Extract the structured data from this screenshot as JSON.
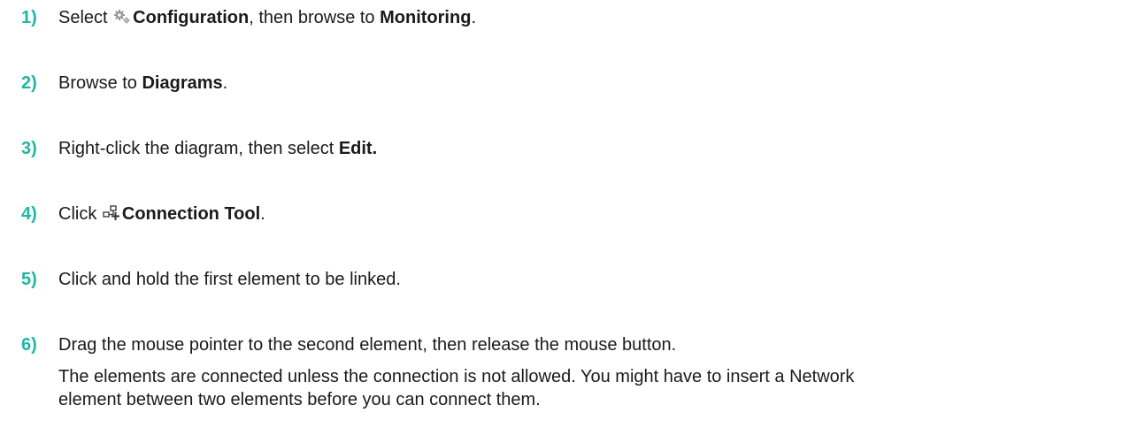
{
  "steps": [
    {
      "number": "1)",
      "pre": "Select ",
      "icon": "gear-icon",
      "bold1": "Configuration",
      "mid": ", then browse to ",
      "bold2": "Monitoring",
      "post": "."
    },
    {
      "number": "2)",
      "pre": "Browse to ",
      "bold1": "Diagrams",
      "post": "."
    },
    {
      "number": "3)",
      "pre": "Right-click the diagram, then select ",
      "bold1": "Edit."
    },
    {
      "number": "4)",
      "pre": "Click ",
      "icon": "connection-tool-icon",
      "bold1": "Connection Tool",
      "post": "."
    },
    {
      "number": "5)",
      "text": "Click and hold the first element to be linked."
    },
    {
      "number": "6)",
      "text": "Drag the mouse pointer to the second element, then release the mouse button.",
      "note_line1": "The elements are connected unless the connection is not allowed. You might have to insert a Network",
      "note_line2": "element between two elements before you can connect them."
    }
  ],
  "colors": {
    "step_number": "#1fb7a4",
    "text": "#1a1a1a",
    "icon": "#9a9a9a"
  }
}
